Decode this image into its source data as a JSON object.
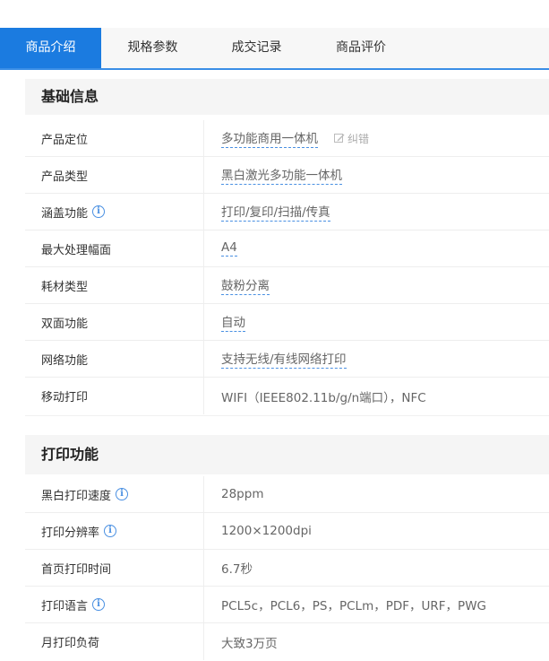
{
  "tabs": [
    "商品介绍",
    "规格参数",
    "成交记录",
    "商品评价"
  ],
  "sections": [
    {
      "title": "基础信息",
      "rows": [
        {
          "label": "产品定位",
          "value": "多功能商用一体机",
          "fix": "纠错"
        },
        {
          "label": "产品类型",
          "value": "黑白激光多功能一体机"
        },
        {
          "label": "涵盖功能",
          "value": "打印/复印/扫描/传真"
        },
        {
          "label": "最大处理幅面",
          "value": "A4"
        },
        {
          "label": "耗材类型",
          "value": "鼓粉分离"
        },
        {
          "label": "双面功能",
          "value": "自动"
        },
        {
          "label": "网络功能",
          "value": "支持无线/有线网络打印"
        },
        {
          "label": "移动打印",
          "value": "WIFI（IEEE802.11b/g/n端口），NFC"
        }
      ]
    },
    {
      "title": "打印功能",
      "rows": [
        {
          "label": "黑白打印速度",
          "value": "28ppm"
        },
        {
          "label": "打印分辨率",
          "value": "1200×1200dpi"
        },
        {
          "label": "首页打印时间",
          "value": "6.7秒"
        },
        {
          "label": "打印语言",
          "value": "PCL5c，PCL6，PS，PCLm，PDF，URF，PWG"
        },
        {
          "label": "月打印负荷",
          "value": "大致3万页"
        }
      ]
    }
  ],
  "info_icon_glyph": "i",
  "colors": {
    "accent": "#1b7be0",
    "link_underline": "#4a90e2"
  }
}
